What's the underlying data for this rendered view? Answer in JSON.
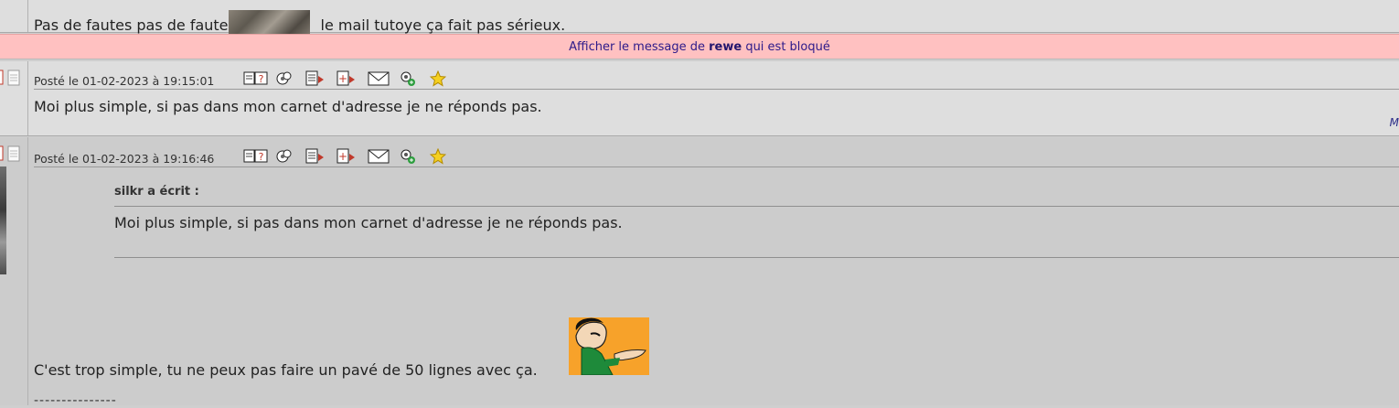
{
  "top_post": {
    "text_before": "Pas de fautes pas de faute",
    "text_after": "le mail tutoye  ça fait pas sérieux."
  },
  "blocked": {
    "prefix": "Afficher le message de ",
    "user": "rewe",
    "suffix": " qui est bloqué"
  },
  "post1": {
    "date": "Posté le 01-02-2023 à 19:15:01",
    "body": "Moi plus simple, si pas dans mon carnet d'adresse je ne réponds pas.",
    "more": "M"
  },
  "post2": {
    "date": "Posté le 01-02-2023 à 19:16:46",
    "quote_author": "silkr a écrit :",
    "quote_text": "Moi plus simple, si pas dans mon carnet d'adresse je ne réponds pas.",
    "body": "C'est trop simple, tu ne peux pas faire un pavé de 50 lignes avec ça.",
    "signature": "---------------"
  },
  "icons": [
    "profile-icon",
    "quote-icon",
    "edit-icon",
    "add-icon",
    "message-icon",
    "alert-icon",
    "favorite-icon"
  ],
  "colors": {
    "blocked_bg": "#ffc1c1",
    "blocked_text": "#2c1a8a",
    "smiley_bg": "#f7a22a"
  }
}
